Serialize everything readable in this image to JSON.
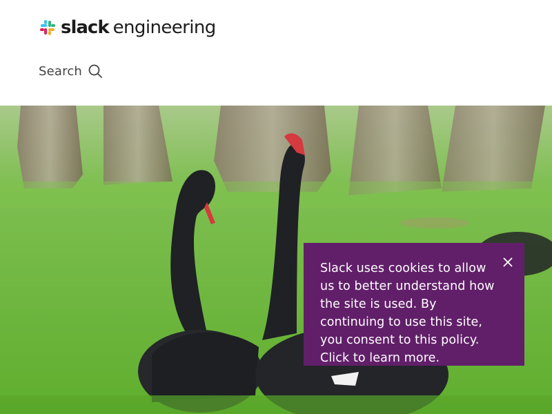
{
  "header": {
    "brand": {
      "wordmark": "slack",
      "suffix": "engineering",
      "logo_icon": "slack-hash-logo-icon",
      "logo_colors": [
        "#36c5f0",
        "#2eb67d",
        "#ecb22e",
        "#e01e5a"
      ]
    },
    "search": {
      "label": "Search",
      "icon": "search-icon"
    }
  },
  "hero": {
    "image": "black swans on grass in a park"
  },
  "cookie_banner": {
    "text": "Slack uses cookies to allow us to better understand how the site is used. By continuing to use this site, you consent to this policy. Click to learn more.",
    "close_icon": "close-icon",
    "background": "#611f69"
  }
}
